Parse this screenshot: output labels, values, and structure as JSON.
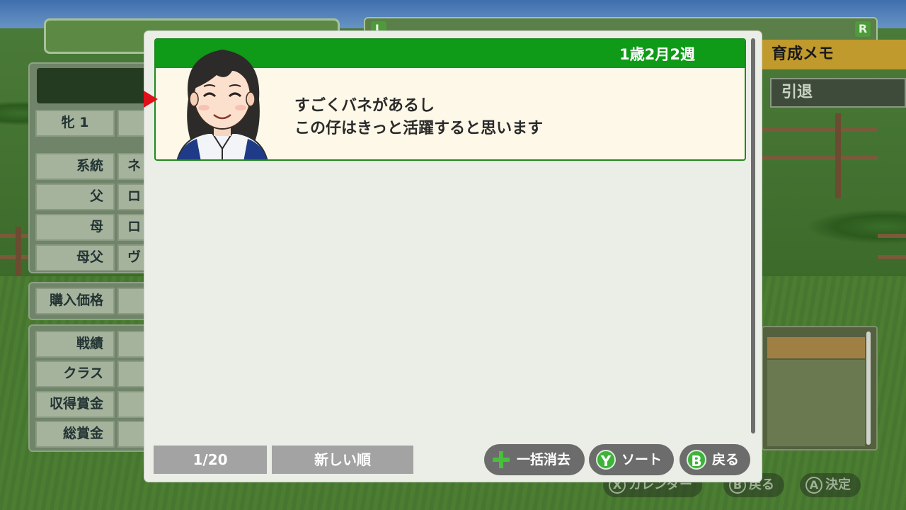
{
  "background": {
    "left_panel": {
      "sex_label": "牝 1",
      "sex_value_partial": "",
      "rows": [
        {
          "label": "系統",
          "value": "ネ"
        },
        {
          "label": "父",
          "value": "ロ"
        },
        {
          "label": "母",
          "value": "ロ"
        },
        {
          "label": "母父",
          "value": "ヴ"
        }
      ],
      "price_label": "購入価格",
      "stats": [
        {
          "label": "戦績"
        },
        {
          "label": "クラス"
        },
        {
          "label": "収得賞金"
        },
        {
          "label": "総賞金"
        }
      ]
    },
    "top_right": {
      "l_badge": "L",
      "r_badge": "R"
    },
    "memo_tab": "育成メモ",
    "retire_button": "引退",
    "bottom_hints": [
      {
        "key": "X",
        "label": "カレンダー"
      },
      {
        "key": "B",
        "label": "戻る"
      },
      {
        "key": "A",
        "label": "決定"
      }
    ]
  },
  "dialog": {
    "memo": {
      "date": "1歳2月2週",
      "lines": [
        "すごくバネがあるし",
        "この仔はきっと活躍すると思います"
      ]
    },
    "page_indicator": "1/20",
    "sort_order": "新しい順",
    "buttons": {
      "clear_all": "一括消去",
      "sort": "ソート",
      "back": "戻る",
      "sort_key": "Y",
      "back_key": "B"
    }
  },
  "colors": {
    "header_green": "#0f9a18",
    "memo_bg": "#fef8e8",
    "cursor_red": "#e0101a",
    "button_gray": "#6c6c6c",
    "icon_green": "#3fb23b"
  }
}
